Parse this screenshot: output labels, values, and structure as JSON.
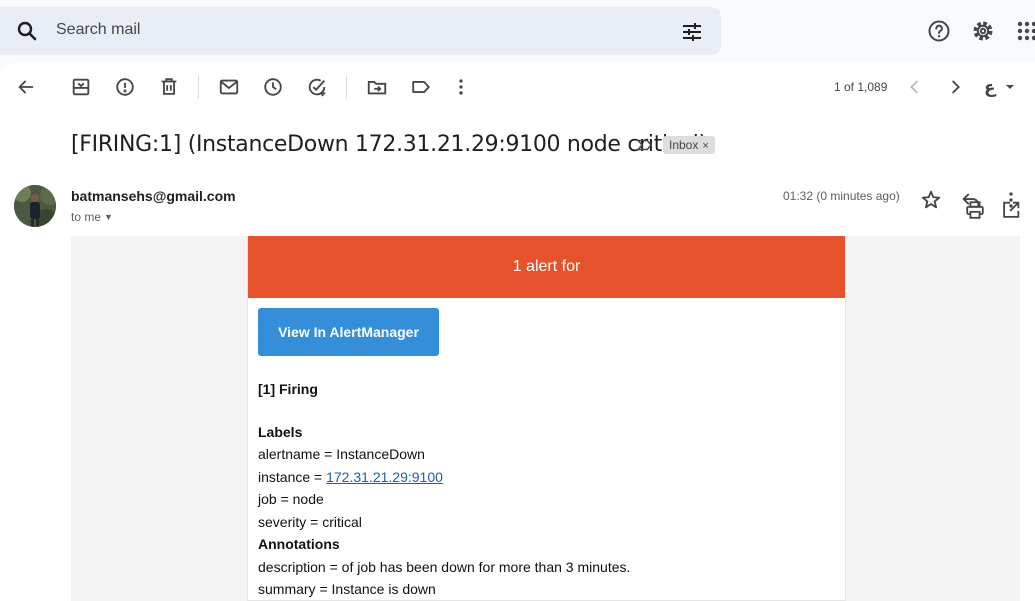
{
  "search": {
    "placeholder": "Search mail"
  },
  "toolbar": {
    "pager": "1 of 1,089"
  },
  "email": {
    "subject": "[FIRING:1] (InstanceDown 172.31.21.29:9100 node critical)",
    "label_chip": "Inbox",
    "label_chip_close": "×",
    "sender": "batmansehs@gmail.com",
    "recipient": "to me",
    "time": "01:32 (0 minutes ago)"
  },
  "alert": {
    "header": "1 alert for",
    "button": "View In AlertManager",
    "section": "[1] Firing",
    "labels_heading": "Labels",
    "labels": {
      "alertname": "alertname = InstanceDown",
      "instance_prefix": "instance = ",
      "instance_link": "172.31.21.29:9100",
      "job": "job = node",
      "severity": "severity = critical"
    },
    "annotations_heading": "Annotations",
    "annotations": {
      "description": "description = of job has been down for more than 3 minutes.",
      "summary": "summary = Instance is down"
    }
  },
  "colors": {
    "alert_bar": "#e6522c",
    "button": "#348eda",
    "search_bg": "#e9eef6",
    "link": "#1a5fb4"
  },
  "icons": [
    "search-icon",
    "tune-icon",
    "help-icon",
    "settings-icon",
    "apps-icon",
    "back-icon",
    "archive-icon",
    "report-spam-icon",
    "delete-icon",
    "mark-unread-icon",
    "snooze-icon",
    "add-task-icon",
    "move-to-icon",
    "label-icon",
    "more-vert-icon",
    "chevron-left-icon",
    "chevron-right-icon",
    "input-tools-icon",
    "importance-icon",
    "print-icon",
    "open-new-window-icon",
    "star-icon",
    "reply-icon"
  ]
}
